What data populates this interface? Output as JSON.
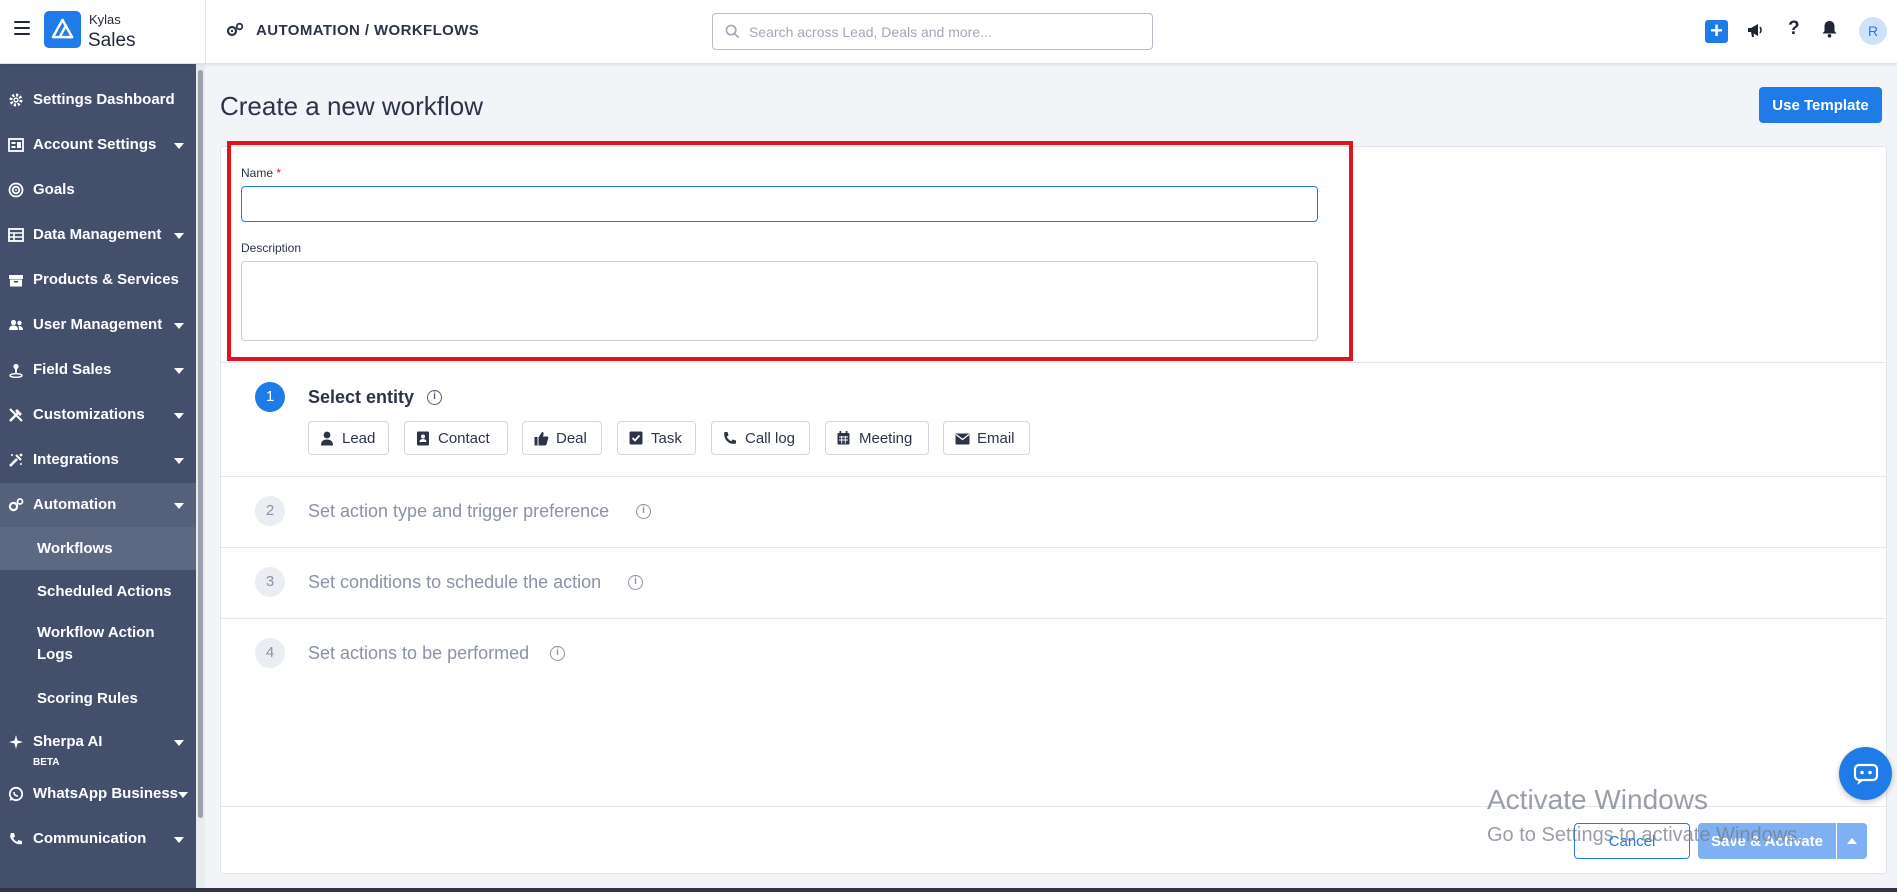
{
  "brand": {
    "top": "Kylas",
    "main": "Sales"
  },
  "breadcrumb": "AUTOMATION / WORKFLOWS",
  "search": {
    "placeholder": "Search across Lead, Deals and more..."
  },
  "user": {
    "initial": "R"
  },
  "sidebar": {
    "items": [
      {
        "label": "Settings Dashboard",
        "icon": "gear-icon"
      },
      {
        "label": "Account Settings",
        "icon": "account-settings-icon"
      },
      {
        "label": "Goals",
        "icon": "target-icon"
      },
      {
        "label": "Data Management",
        "icon": "table-icon"
      },
      {
        "label": "Products & Services",
        "icon": "box-icon"
      },
      {
        "label": "User Management",
        "icon": "users-icon"
      },
      {
        "label": "Field Sales",
        "icon": "map-pin-icon"
      },
      {
        "label": "Customizations",
        "icon": "tools-icon"
      },
      {
        "label": "Integrations",
        "icon": "integration-icon"
      },
      {
        "label": "Automation",
        "icon": "gears-icon"
      }
    ],
    "automation_sub": [
      "Workflows",
      "Scheduled Actions",
      "Workflow Action Logs",
      "Scoring Rules"
    ],
    "sherpa": {
      "label": "Sherpa AI",
      "badge": "BETA"
    },
    "whatsapp": "WhatsApp Business",
    "communication": "Communication"
  },
  "page": {
    "title": "Create a new workflow",
    "use_template": "Use Template"
  },
  "form": {
    "name_label": "Name",
    "required_mark": "*",
    "name_value": "",
    "description_label": "Description",
    "description_value": ""
  },
  "steps": [
    {
      "number": "1",
      "title": "Select entity",
      "active": true
    },
    {
      "number": "2",
      "title": "Set action type and trigger preference",
      "active": false
    },
    {
      "number": "3",
      "title": "Set conditions to schedule the action",
      "active": false
    },
    {
      "number": "4",
      "title": "Set actions to be performed",
      "active": false
    }
  ],
  "entities": [
    {
      "label": "Lead",
      "icon": "person-icon"
    },
    {
      "label": "Contact",
      "icon": "contact-card-icon"
    },
    {
      "label": "Deal",
      "icon": "thumbs-up-icon"
    },
    {
      "label": "Task",
      "icon": "checkbox-icon"
    },
    {
      "label": "Call log",
      "icon": "phone-icon"
    },
    {
      "label": "Meeting",
      "icon": "calendar-icon"
    },
    {
      "label": "Email",
      "icon": "envelope-icon"
    }
  ],
  "footer": {
    "cancel": "Cancel",
    "save": "Save & Activate"
  },
  "watermark": {
    "line1": "Activate Windows",
    "line2": "Go to Settings to activate Windows."
  },
  "colors": {
    "primary": "#1e7be8",
    "sidebar": "#44506b",
    "highlight": "#e0141e"
  }
}
